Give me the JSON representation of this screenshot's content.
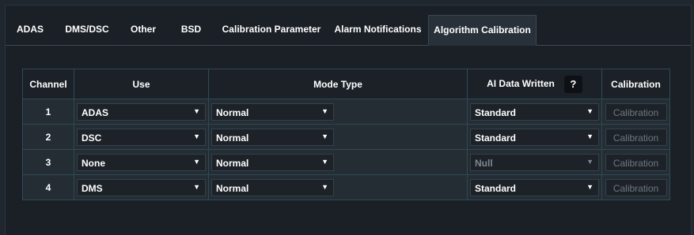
{
  "tabs": [
    {
      "label": "ADAS"
    },
    {
      "label": "DMS/DSC"
    },
    {
      "label": "Other"
    },
    {
      "label": "BSD"
    },
    {
      "label": "Calibration Parameter"
    },
    {
      "label": "Alarm Notifications"
    },
    {
      "label": "Algorithm Calibration",
      "active": true
    }
  ],
  "table": {
    "headers": {
      "channel": "Channel",
      "use": "Use",
      "mode_type": "Mode Type",
      "ai_data_written": "AI Data Written",
      "help_icon": "?",
      "calibration": "Calibration"
    },
    "rows": [
      {
        "channel": "1",
        "use": "ADAS",
        "mode": "Normal",
        "ai": "Standard",
        "calibration": "Calibration"
      },
      {
        "channel": "2",
        "use": "DSC",
        "mode": "Normal",
        "ai": "Standard",
        "calibration": "Calibration"
      },
      {
        "channel": "3",
        "use": "None",
        "mode": "Normal",
        "ai": "Null",
        "ai_disabled": true,
        "calibration": "Calibration"
      },
      {
        "channel": "4",
        "use": "DMS",
        "mode": "Normal",
        "ai": "Standard",
        "calibration": "Calibration"
      }
    ]
  },
  "colors": {
    "background": "#1a2026",
    "row_background": "#242c34",
    "border": "#2f4a55",
    "text": "#ffffff",
    "disabled_text": "#6f7780"
  },
  "icons": {
    "dropdown": "chevron-down-icon",
    "help": "question-icon"
  }
}
